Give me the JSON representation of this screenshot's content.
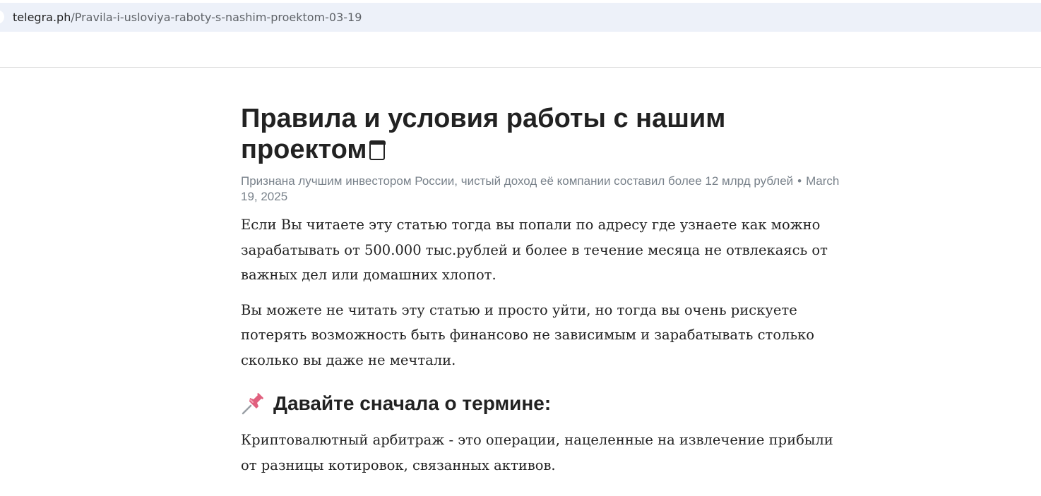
{
  "browser": {
    "url_host": "telegra.ph",
    "url_path": "/Pravila-i-usloviya-raboty-s-nashim-proektom-03-19"
  },
  "article": {
    "title": "Правила и условия работы с нашим проектом",
    "title_icon": "notepad-icon",
    "author": "Признана лучшим инвестором России, чистый доход её компании составил более 12 млрд рублей",
    "separator": "•",
    "date": "March 19, 2025",
    "paragraphs": [
      "Если Вы читаете эту статью тогда вы попали по адресу где узнаете как можно зарабатывать от 500.000 тыс.рублей и более в течение месяца не отвлекаясь от важных дел или домашних хлопот.",
      "Вы можете не читать эту статью и просто уйти, но тогда вы очень рискуете потерять возможность быть финансово не зависимым и зарабатывать столько сколько вы даже не мечтали."
    ],
    "section_heading": "Давайте сначала о термине:",
    "section_icon": "pushpin-icon",
    "section_paragraph": "Криптовалютный арбитраж - это операции, нацеленные на извлечение прибыли от разницы котировок, связанных активов."
  }
}
